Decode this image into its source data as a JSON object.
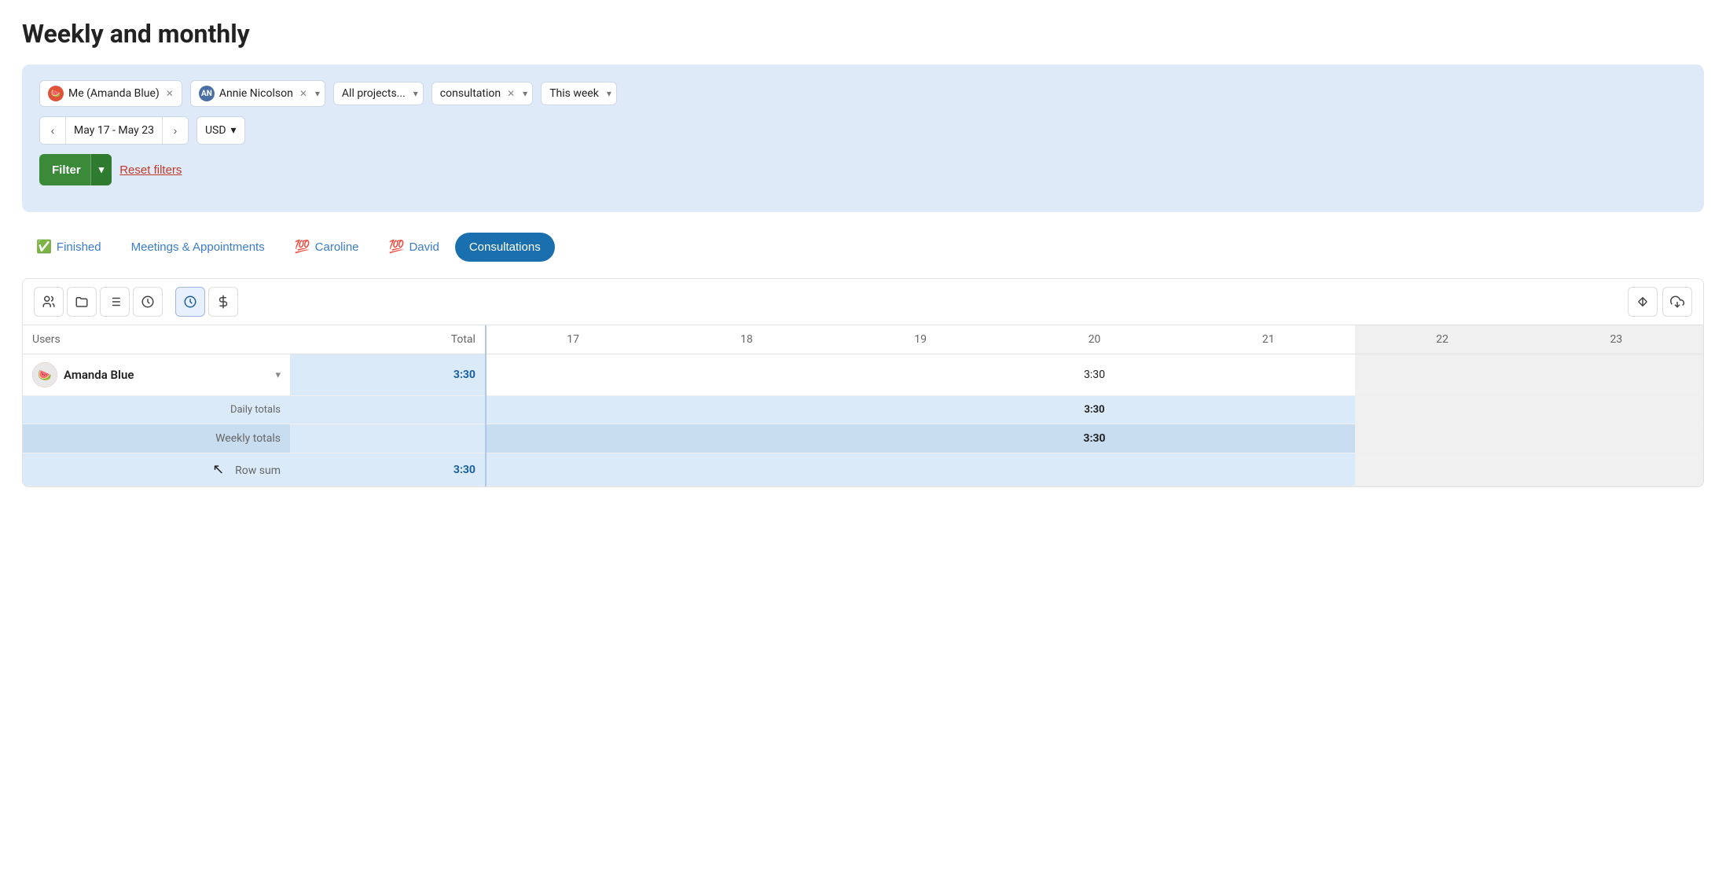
{
  "page": {
    "title": "Weekly and monthly"
  },
  "filters": {
    "users": [
      {
        "name": "Me (Amanda Blue)",
        "type": "me"
      },
      {
        "name": "Annie Nicolson",
        "type": "other"
      }
    ],
    "users_dropdown_placeholder": "▾",
    "projects": "All projects...",
    "task_type": "consultation",
    "time_period": "This week",
    "date_range": "May 17 - May 23",
    "currency": "USD",
    "filter_btn": "Filter",
    "reset_link": "Reset filters"
  },
  "tabs": [
    {
      "id": "finished",
      "label": "Finished",
      "emoji": "✅",
      "active": false
    },
    {
      "id": "meetings",
      "label": "Meetings & Appointments",
      "emoji": "",
      "active": false
    },
    {
      "id": "caroline",
      "label": "Caroline",
      "emoji": "💯",
      "active": false
    },
    {
      "id": "david",
      "label": "David",
      "emoji": "💯",
      "active": false
    },
    {
      "id": "consultations",
      "label": "Consultations",
      "emoji": "",
      "active": true
    }
  ],
  "toolbar": {
    "icons": [
      "users",
      "folder",
      "list",
      "clock-circle",
      "clock-filled",
      "dollar"
    ],
    "sort_btn": "↕",
    "export_btn": "↑□"
  },
  "table": {
    "columns": {
      "users": "Users",
      "total": "Total",
      "days": [
        "17",
        "18",
        "19",
        "20",
        "21",
        "22",
        "23"
      ]
    },
    "rows": [
      {
        "user": "Amanda Blue",
        "total": "3:30",
        "days": [
          "",
          "",
          "",
          "3:30",
          "",
          "",
          ""
        ]
      }
    ],
    "daily_totals": {
      "label": "Daily totals",
      "total": "",
      "days": [
        "",
        "",
        "",
        "3:30",
        "",
        "",
        ""
      ]
    },
    "weekly_totals": {
      "label": "Weekly totals",
      "total": "",
      "days": [
        "",
        "",
        "",
        "3:30",
        "",
        "",
        ""
      ]
    },
    "row_sum": {
      "label": "Row sum",
      "value": "3:30"
    }
  },
  "colors": {
    "accent_blue": "#1a6faf",
    "light_blue_bg": "#daeaf8",
    "filter_bg": "#deeaf7",
    "green_btn": "#3a8a3a",
    "weekend_bg": "#f0f0f0"
  }
}
